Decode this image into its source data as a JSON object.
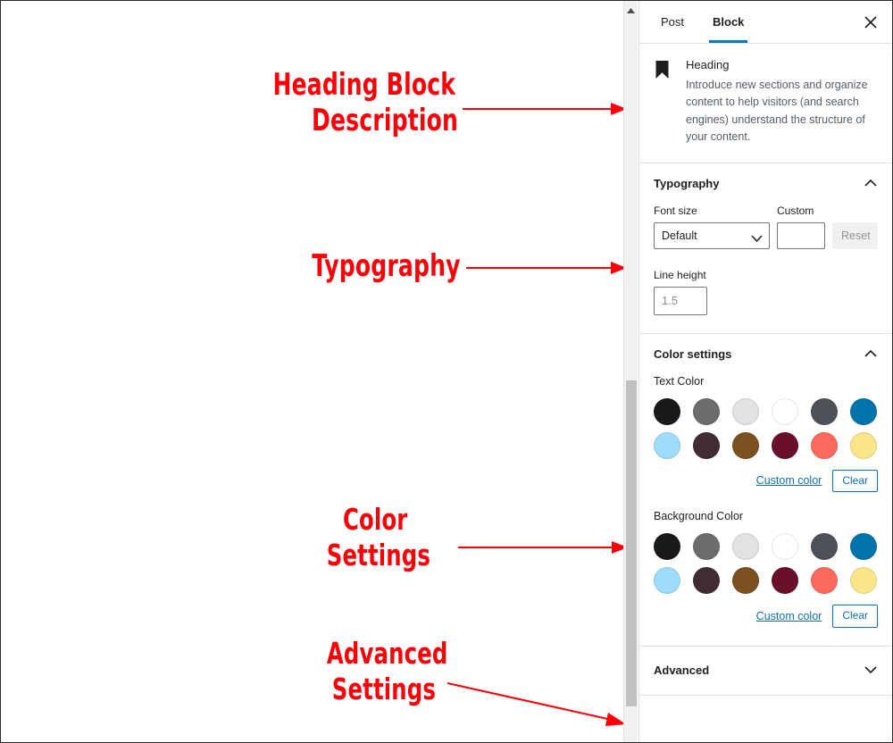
{
  "annotations": [
    {
      "id": "heading-block-description",
      "lines": [
        "Heading Block",
        "Description"
      ]
    },
    {
      "id": "typography",
      "lines": [
        "Typography"
      ]
    },
    {
      "id": "color-settings",
      "lines": [
        "Color",
        "Settings"
      ]
    },
    {
      "id": "advanced-settings",
      "lines": [
        "Advanced",
        "Settings"
      ]
    }
  ],
  "annotation_color": "#fb0007",
  "accent_color": "#007cba",
  "link_color": "#0f6fb0",
  "panel": {
    "tabs": [
      {
        "label": "Post",
        "active": false
      },
      {
        "label": "Block",
        "active": true
      }
    ],
    "close_label": "✕",
    "block": {
      "icon": "heading-bookmark-icon",
      "title": "Heading",
      "description": "Introduce new sections and organize content to help visitors (and search engines) understand the structure of your content."
    },
    "typography": {
      "title": "Typography",
      "collapse_state": "expanded",
      "font_size_label": "Font size",
      "font_size_value": "Default",
      "font_size_options": [
        "Default"
      ],
      "custom_label": "Custom",
      "custom_value": "",
      "custom_placeholder": "",
      "reset_label": "Reset",
      "line_height_label": "Line height",
      "line_height_value": "",
      "line_height_placeholder": "1.5"
    },
    "color_settings": {
      "title": "Color settings",
      "collapse_state": "expanded",
      "text_color_label": "Text Color",
      "background_color_label": "Background Color",
      "custom_color_label": "Custom color",
      "clear_label": "Clear",
      "swatches": [
        "#191919",
        "#6c6c6c",
        "#e2e2e2",
        "#ffffff",
        "#4c5258",
        "#0073ac",
        "#9fdcf9",
        "#3f2d33",
        "#7a5021",
        "#69102a",
        "#fc6a5e",
        "#fbe58a"
      ]
    },
    "advanced": {
      "title": "Advanced",
      "collapse_state": "collapsed"
    }
  },
  "scrollbar": {
    "up_arrow": "scroll-up-arrow-icon",
    "thumb_color": "#c1c1c1",
    "track_color": "#f1f1f1"
  }
}
